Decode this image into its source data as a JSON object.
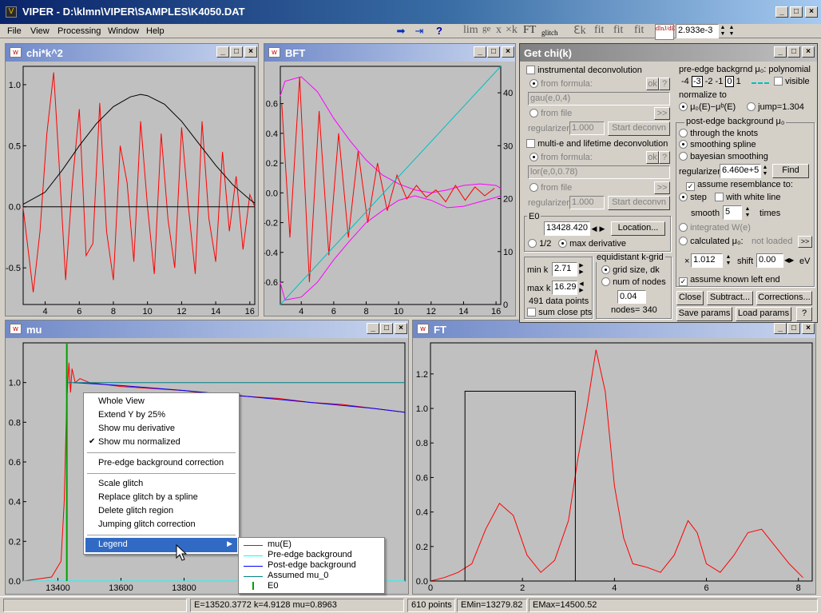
{
  "app": {
    "title": "VIPER - D:\\klmn\\VIPER\\SAMPLES\\K4050.DAT",
    "menu": [
      "File",
      "View",
      "Processing",
      "Window",
      "Help"
    ],
    "toolbar_glyphs": [
      "lim",
      "ge",
      "x",
      "×k",
      "FT",
      "glitch",
      "ℇk",
      "fit",
      "fit",
      "fit"
    ],
    "toolbar_value": "2.933e-3",
    "toolbar_deriv_label": "dlnJ/dE"
  },
  "windows": {
    "chik2": {
      "title": "chi*k^2"
    },
    "bft": {
      "title": "BFT"
    },
    "mu": {
      "title": "mu"
    },
    "ft": {
      "title": "FT"
    }
  },
  "getchi": {
    "title": "Get chi(k)",
    "instrumental_deconvolution": "instrumental deconvolution",
    "from_formula": "from formula:",
    "formula1": "gau(e,0,4)",
    "from_file": "from file",
    "regularizer_label": "regularizer",
    "regularizer1": "1.000",
    "start_deconvn": "Start deconvn",
    "multi_e": "multi-e and lifetime deconvolution",
    "formula2": "lor(e,0,0.78)",
    "regularizer2": "1.000",
    "ok": "ok",
    "q": "?",
    "browse": ">>",
    "e0_label": "E0",
    "e0_value": "13428.420",
    "location": "Location...",
    "half": "1/2",
    "max_derivative": "max derivative",
    "min_k_label": "min k",
    "min_k": "2.71",
    "max_k_label": "max k",
    "max_k": "16.29",
    "data_points": "491  data points",
    "sum_close": "sum close pts",
    "equidistant": "equidistant k-grid",
    "grid_size": "grid size, dk",
    "num_nodes": "num of nodes",
    "dk": "0.04",
    "nodes": "nodes= 340",
    "pre_edge_title": "pre-edge backgrnd μ₀: polynomial",
    "poly_orders": [
      "-4",
      "-3",
      "-2",
      "-1",
      "0",
      "1"
    ],
    "visible": "visible",
    "normalize_to": "normalize to",
    "norm1": "μ₀(E)−μᵇ(E)",
    "jump": "jump=1.304",
    "post_edge_title": "post-edge background μ₀",
    "through_knots": "through the knots",
    "smoothing_spline": "smoothing spline",
    "bayesian": "bayesian smoothing",
    "regularizer3": "6.460e+5",
    "find": "Find",
    "assume_resemblance": "assume resemblance to:",
    "step": "step",
    "with_white_line": "with white line",
    "smooth_label": "smooth",
    "smooth_value": "5",
    "times": "times",
    "integrated": "integrated W(e)",
    "calculated": "calculated μ₀:",
    "not_loaded": "not loaded",
    "mult_x": "×",
    "mult_value": "1.012",
    "shift_label": "shift",
    "shift_value": "0.00",
    "ev": "eV",
    "assume_known": "assume known left end",
    "close": "Close",
    "subtract": "Subtract...",
    "corrections": "Corrections...",
    "save_params": "Save params",
    "load_params": "Load params",
    "help": "?"
  },
  "context_menu": {
    "items": [
      "Whole View",
      "Extend Y by 25%",
      "Show mu derivative",
      "Show mu normalized",
      "Pre-edge background correction",
      "Scale glitch",
      "Replace glitch by a spline",
      "Delete glitch region",
      "Jumping glitch correction",
      "Legend"
    ],
    "checked": "Show mu normalized"
  },
  "legend": {
    "items": [
      {
        "label": "mu(E)",
        "color": "#ff0000"
      },
      {
        "label": "Pre-edge background",
        "color": "#00ffff"
      },
      {
        "label": "Post-edge background",
        "color": "#0000ff"
      },
      {
        "label": "Assumed mu_0",
        "color": "#008080"
      },
      {
        "label": "E0",
        "color": "#00a000"
      }
    ]
  },
  "status": {
    "coords": "E=13520.3772   k=4.9128   mu=0.8963",
    "points": "610 points",
    "emin": "EMin=13279.82",
    "emax": "EMax=14500.52"
  },
  "chart_data": [
    {
      "type": "line",
      "window": "chi*k^2",
      "xlim": [
        2.71,
        16.29
      ],
      "ylim": [
        -0.8,
        1.15
      ],
      "xticks": [
        4,
        6,
        8,
        10,
        12,
        14,
        16
      ],
      "yticks": [
        1.0,
        0.5,
        0.0,
        -0.5
      ],
      "series": [
        {
          "color": "#ff0000",
          "x": [
            2.7,
            3.0,
            3.3,
            3.7,
            4.1,
            4.5,
            4.8,
            5.2,
            5.6,
            6.0,
            6.4,
            6.8,
            7.2,
            7.6,
            8.0,
            8.4,
            8.8,
            9.2,
            9.6,
            10.0,
            10.4,
            10.8,
            11.2,
            11.6,
            12.0,
            12.4,
            12.8,
            13.2,
            13.6,
            14.0,
            14.4,
            14.8,
            15.2,
            15.6,
            16.0,
            16.29
          ],
          "y": [
            0.0,
            -0.35,
            -0.7,
            -0.2,
            0.6,
            1.1,
            0.4,
            -0.6,
            0.2,
            0.8,
            -0.4,
            -0.3,
            0.85,
            -0.2,
            -0.6,
            0.5,
            0.2,
            -0.45,
            0.7,
            0.0,
            -0.55,
            0.6,
            -0.1,
            -0.5,
            0.65,
            0.0,
            -0.55,
            0.7,
            -0.1,
            -0.45,
            0.45,
            -0.2,
            0.25,
            -0.35,
            0.1,
            0.0
          ]
        },
        {
          "color": "#000000",
          "x": [
            2.7,
            4,
            5,
            6,
            7,
            8,
            9,
            9.6,
            10,
            11,
            12,
            13,
            14,
            15,
            16,
            16.29
          ],
          "y": [
            0.02,
            0.12,
            0.3,
            0.5,
            0.68,
            0.82,
            0.9,
            0.92,
            0.91,
            0.84,
            0.7,
            0.52,
            0.34,
            0.18,
            0.06,
            0.03
          ]
        },
        {
          "color": "#000000",
          "x": [
            2.71,
            16.29
          ],
          "y": [
            0.0,
            0.0
          ]
        }
      ]
    },
    {
      "type": "line",
      "window": "BFT",
      "xlim": [
        2.71,
        16.29
      ],
      "ylim_left": [
        -0.75,
        0.85
      ],
      "ylim_right": [
        0,
        45
      ],
      "xticks": [
        4,
        6,
        8,
        10,
        12,
        14,
        16
      ],
      "yticks_left": [
        0.6,
        0.4,
        0.2,
        0.0,
        -0.2,
        -0.4,
        -0.6
      ],
      "yticks_right": [
        40,
        30,
        20,
        10,
        0
      ],
      "series": [
        {
          "color": "#ff00ff",
          "x": [
            2.7,
            3,
            4,
            5,
            6,
            7,
            8,
            9,
            10,
            11,
            12,
            13,
            14,
            15,
            16,
            16.29
          ],
          "y": [
            0.65,
            0.75,
            0.78,
            0.68,
            0.5,
            0.35,
            0.22,
            0.12,
            0.06,
            0.02,
            0.0,
            0.02,
            0.05,
            0.06,
            0.05,
            0.03
          ]
        },
        {
          "color": "#ff00ff",
          "x": [
            2.7,
            3,
            4,
            5,
            6,
            7,
            8,
            9,
            10,
            11,
            12,
            13,
            14,
            15,
            16,
            16.29
          ],
          "y": [
            -0.6,
            -0.72,
            -0.7,
            -0.6,
            -0.45,
            -0.32,
            -0.2,
            -0.12,
            -0.05,
            -0.02,
            -0.05,
            -0.1,
            -0.09,
            -0.06,
            -0.03,
            -0.02
          ]
        },
        {
          "color": "#ff0000",
          "x": [
            2.8,
            3.3,
            3.9,
            4.5,
            5.1,
            5.7,
            6.3,
            6.9,
            7.5,
            8.1,
            8.7,
            9.3,
            9.9,
            10.5,
            11.1,
            11.7,
            12.3,
            12.9,
            13.5,
            14.1,
            14.7,
            15.3,
            15.9
          ],
          "y": [
            0.6,
            -0.3,
            0.78,
            -0.6,
            0.55,
            -0.42,
            0.4,
            -0.3,
            0.28,
            -0.2,
            0.2,
            -0.12,
            0.12,
            -0.04,
            0.05,
            -0.03,
            0.02,
            -0.06,
            0.05,
            -0.05,
            0.04,
            -0.02,
            0.03
          ]
        },
        {
          "color": "#00c0c0",
          "axis": "right",
          "x": [
            2.71,
            16.29
          ],
          "y": [
            0,
            45
          ]
        }
      ]
    },
    {
      "type": "line",
      "window": "mu",
      "xlim": [
        13290,
        14500
      ],
      "ylim": [
        0.0,
        1.2
      ],
      "xticks": [
        13400,
        13600,
        13800
      ],
      "yticks": [
        1.0,
        0.8,
        0.6,
        0.4,
        0.2,
        0.0
      ],
      "series": [
        {
          "name": "mu(E)",
          "color": "#ff0000",
          "x": [
            13290,
            13380,
            13410,
            13420,
            13428,
            13435,
            13440,
            13445,
            13455,
            13470,
            13500,
            13550,
            13600,
            13700,
            13800,
            13900,
            14000,
            14100,
            14200,
            14300,
            14400,
            14500
          ],
          "y": [
            0.0,
            0.02,
            0.1,
            0.4,
            0.9,
            1.1,
            0.95,
            1.07,
            1.0,
            1.02,
            1.0,
            0.99,
            0.98,
            0.97,
            0.96,
            0.94,
            0.93,
            0.92,
            0.9,
            0.89,
            0.87,
            0.85
          ]
        },
        {
          "name": "Pre-edge background",
          "color": "#00ffff",
          "x": [
            13290,
            14500
          ],
          "y": [
            0.0,
            0.0
          ]
        },
        {
          "name": "Post-edge background",
          "color": "#0000ff",
          "x": [
            13450,
            13600,
            13800,
            14000,
            14200,
            14400,
            14500
          ],
          "y": [
            1.0,
            0.985,
            0.96,
            0.93,
            0.9,
            0.87,
            0.85
          ]
        },
        {
          "name": "Assumed mu_0",
          "color": "#008080",
          "x": [
            13428,
            14500
          ],
          "y": [
            1.0,
            1.0
          ]
        }
      ],
      "markers": {
        "E0": 13428.42
      }
    },
    {
      "type": "line",
      "window": "FT",
      "xlim": [
        0,
        8.3
      ],
      "ylim": [
        0,
        1.38
      ],
      "xticks": [
        0,
        2,
        4,
        6,
        8
      ],
      "yticks": [
        1.2,
        1.0,
        0.8,
        0.6,
        0.4,
        0.2,
        0.0
      ],
      "series": [
        {
          "color": "#ff0000",
          "x": [
            0,
            0.3,
            0.6,
            0.9,
            1.2,
            1.5,
            1.8,
            2.1,
            2.4,
            2.7,
            3.0,
            3.2,
            3.4,
            3.6,
            3.8,
            4.0,
            4.2,
            4.4,
            4.7,
            5.0,
            5.3,
            5.6,
            5.8,
            6.0,
            6.3,
            6.6,
            6.9,
            7.2,
            7.5,
            7.8,
            8.1
          ],
          "y": [
            0.0,
            0.02,
            0.05,
            0.1,
            0.3,
            0.45,
            0.38,
            0.15,
            0.05,
            0.12,
            0.35,
            0.7,
            1.0,
            1.34,
            1.1,
            0.55,
            0.25,
            0.1,
            0.08,
            0.05,
            0.15,
            0.35,
            0.28,
            0.1,
            0.05,
            0.15,
            0.28,
            0.3,
            0.2,
            0.1,
            0.02
          ]
        },
        {
          "color": "#000000",
          "x": [
            0,
            0.75,
            0.75,
            3.15,
            3.15,
            8.3
          ],
          "y": [
            0,
            0,
            1.1,
            1.1,
            0,
            0
          ]
        }
      ]
    }
  ]
}
